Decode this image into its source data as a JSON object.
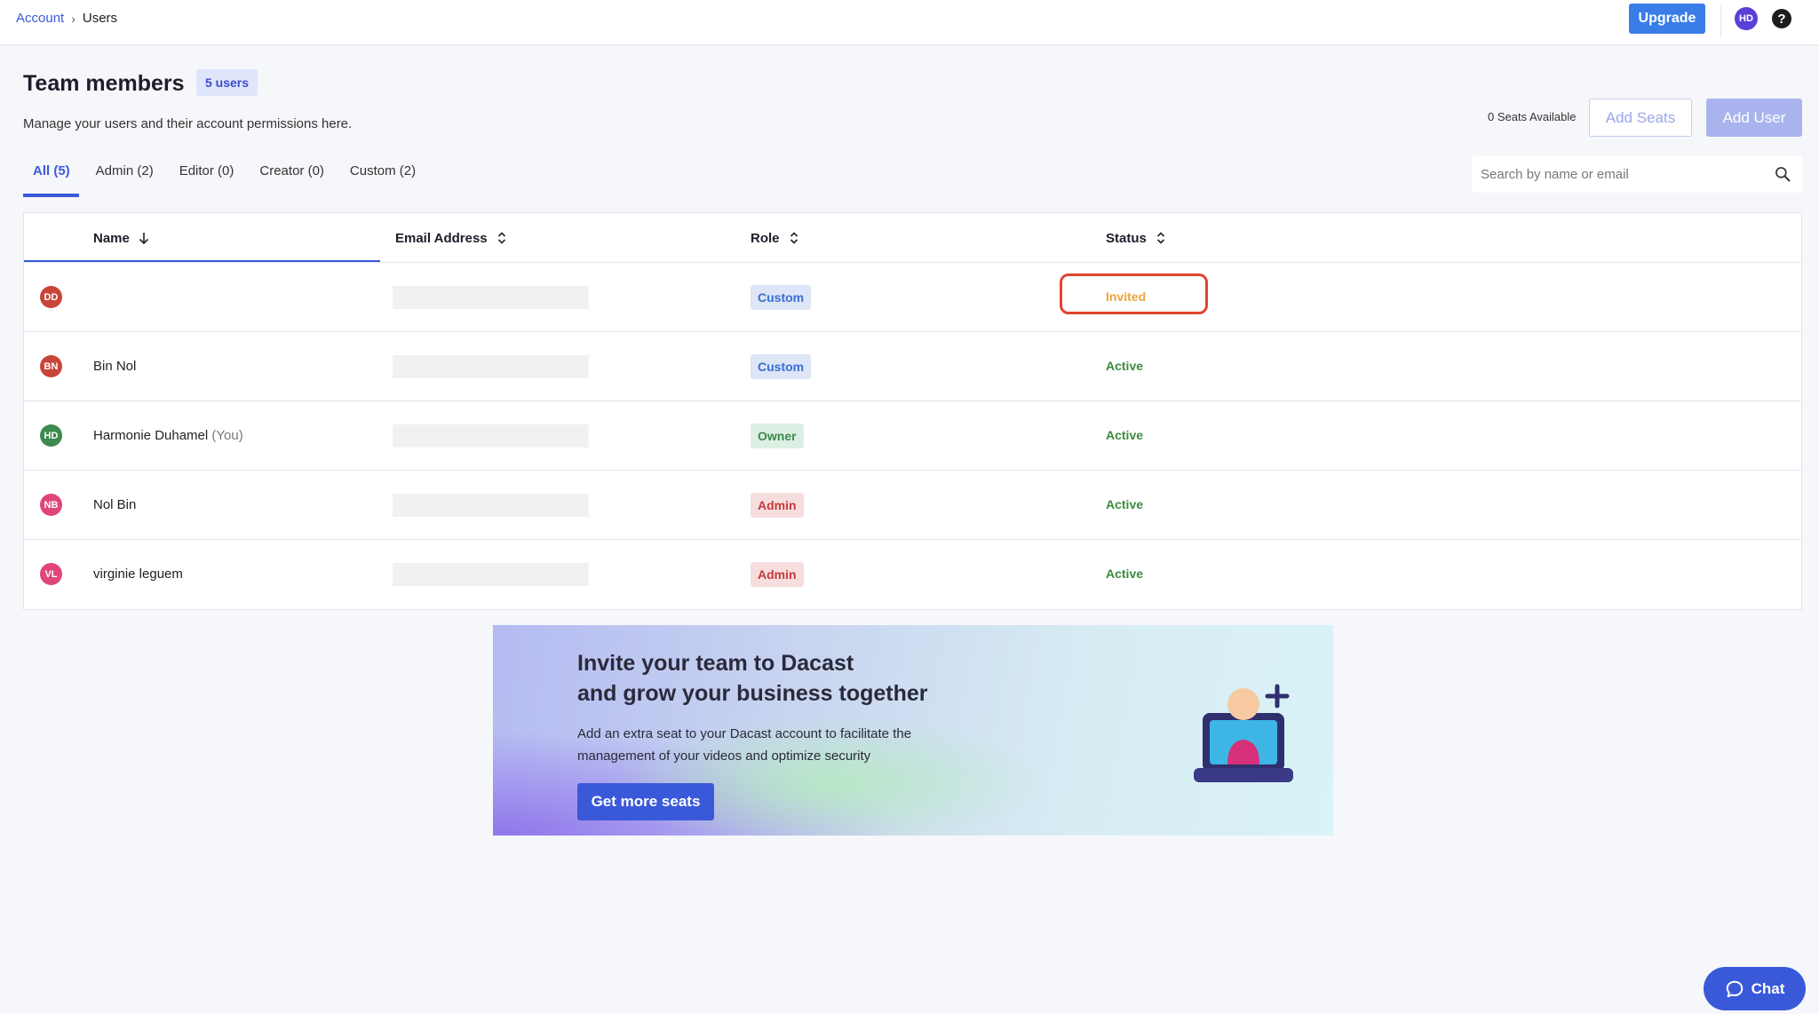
{
  "breadcrumb": {
    "account": "Account",
    "separator": "›",
    "current": "Users"
  },
  "topbar": {
    "upgrade_label": "Upgrade",
    "avatar_initials": "HD",
    "help_glyph": "?"
  },
  "header": {
    "title": "Team members",
    "count_badge": "5 users",
    "subtitle": "Manage your users and their account permissions here.",
    "seats_available": "0 Seats Available",
    "add_seats_label": "Add Seats",
    "add_user_label": "Add User"
  },
  "tabs": [
    {
      "label": "All (5)",
      "active": true
    },
    {
      "label": "Admin (2)",
      "active": false
    },
    {
      "label": "Editor (0)",
      "active": false
    },
    {
      "label": "Creator (0)",
      "active": false
    },
    {
      "label": "Custom (2)",
      "active": false
    }
  ],
  "search": {
    "placeholder": "Search by name or email"
  },
  "table": {
    "columns": {
      "name": "Name",
      "email": "Email Address",
      "role": "Role",
      "status": "Status"
    },
    "rows": [
      {
        "initials": "DD",
        "avatar_color": "#c8453a",
        "name": "",
        "you": "",
        "role": "Custom",
        "role_kind": "custom",
        "status": "Invited",
        "status_kind": "invited",
        "highlighted": true
      },
      {
        "initials": "BN",
        "avatar_color": "#c8453a",
        "name": "Bin Nol",
        "you": "",
        "role": "Custom",
        "role_kind": "custom",
        "status": "Active",
        "status_kind": "active",
        "highlighted": false
      },
      {
        "initials": "HD",
        "avatar_color": "#3d8a4f",
        "name": "Harmonie Duhamel",
        "you": "(You)",
        "role": "Owner",
        "role_kind": "owner",
        "status": "Active",
        "status_kind": "active",
        "highlighted": false
      },
      {
        "initials": "NB",
        "avatar_color": "#e0457b",
        "name": "Nol Bin",
        "you": "",
        "role": "Admin",
        "role_kind": "admin",
        "status": "Active",
        "status_kind": "active",
        "highlighted": false
      },
      {
        "initials": "VL",
        "avatar_color": "#e0457b",
        "name": "virginie leguem",
        "you": "",
        "role": "Admin",
        "role_kind": "admin",
        "status": "Active",
        "status_kind": "active",
        "highlighted": false
      }
    ]
  },
  "promo": {
    "title_line1": "Invite your team to Dacast",
    "title_line2": "and grow your business together",
    "text": "Add an extra seat to your Dacast account to facilitate the management of your videos and optimize security",
    "button_label": "Get more seats"
  },
  "chat": {
    "label": "Chat"
  },
  "colors": {
    "accent": "#3a59d9",
    "upgrade": "#3a7ce8",
    "highlight": "#e0442f"
  }
}
